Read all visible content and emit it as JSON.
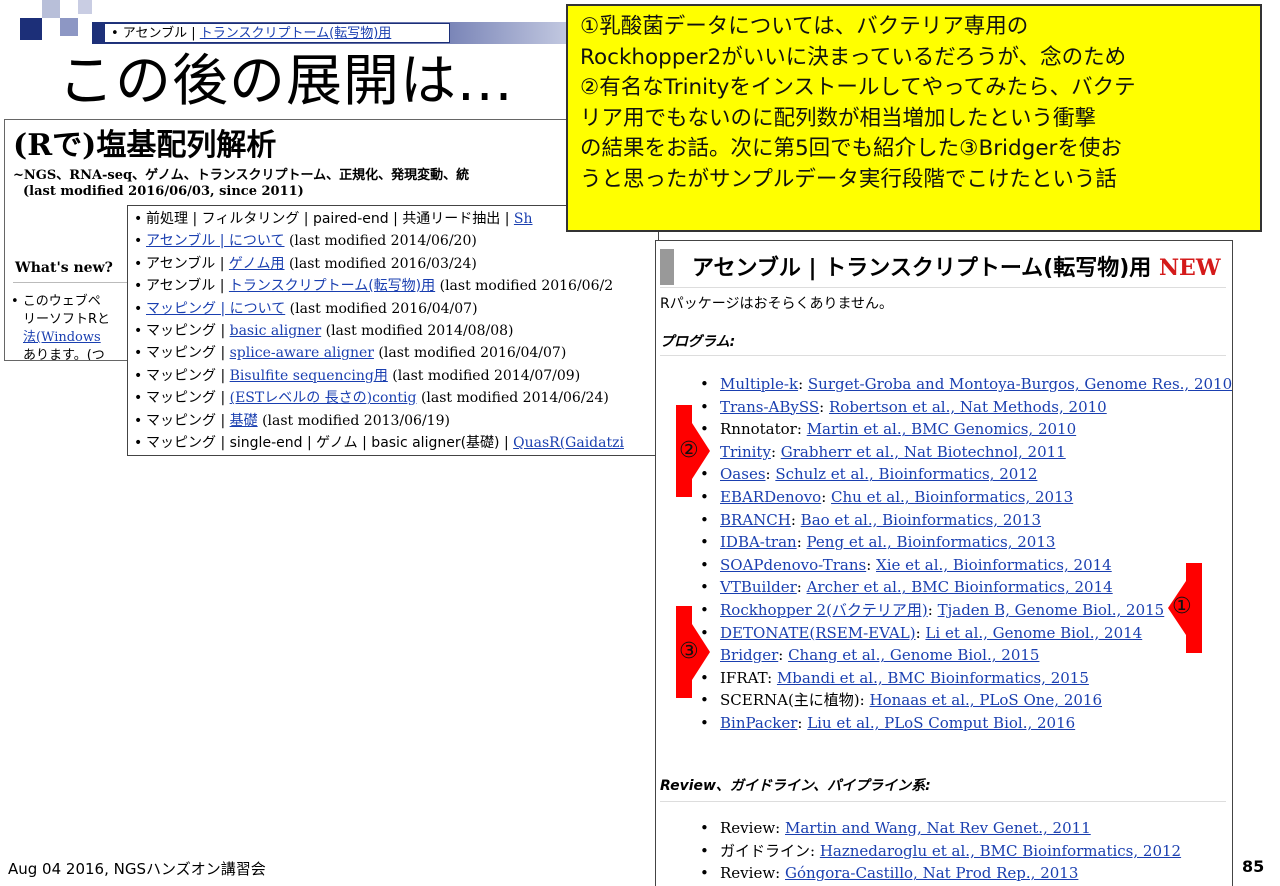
{
  "breadcrumb": {
    "prefix": "• アセンブル | ",
    "link": "トランスクリプトーム(転写物)用"
  },
  "slide_title": "この後の展開は...",
  "site": {
    "title": "(Rで)塩基配列解析",
    "subtitle": "~NGS、RNA-seq、ゲノム、トランスクリプトーム、正規化、発現変動、統",
    "modified": "(last modified 2016/06/03, since 2011)",
    "whats_new": "What's new?",
    "news_lines": [
      "• このウェブペ",
      "リーソフトRと",
      "法(Windows",
      "あります。(つ"
    ]
  },
  "menu": {
    "items": [
      {
        "pre": "前処理 | フィルタリング | paired-end | 共通リード抽出 | ",
        "link": "Sh",
        "post": ""
      },
      {
        "pre": "",
        "link": "アセンブル | について",
        "post": " (last modified 2014/06/20)"
      },
      {
        "pre": "アセンブル | ",
        "link": "ゲノム用",
        "post": " (last modified 2016/03/24)"
      },
      {
        "pre": "アセンブル | ",
        "link": "トランスクリプトーム(転写物)用",
        "post": " (last modified 2016/06/2"
      },
      {
        "pre": "",
        "link": "マッピング | について",
        "post": " (last modified 2016/04/07)"
      },
      {
        "pre": "マッピング | ",
        "link": "basic aligner",
        "post": " (last modified 2014/08/08)"
      },
      {
        "pre": "マッピング | ",
        "link": "splice-aware aligner",
        "post": " (last modified 2016/04/07)"
      },
      {
        "pre": "マッピング | ",
        "link": "Bisulfite sequencing用",
        "post": " (last modified 2014/07/09)"
      },
      {
        "pre": "マッピング | ",
        "link": "(ESTレベルの 長さの)contig",
        "post": " (last modified 2014/06/24)"
      },
      {
        "pre": "マッピング | ",
        "link": "基礎",
        "post": " (last modified 2013/06/19)"
      },
      {
        "pre": "マッピング | single-end | ゲノム | basic aligner(基礎) | ",
        "link": "QuasR(Gaidatzi",
        "post": ""
      }
    ]
  },
  "callout": {
    "lines": [
      "①乳酸菌データについては、バクテリア専用の",
      "Rockhopper2がいいに決まっているだろうが、念のため",
      "②有名なTrinityをインストールしてやってみたら、バクテ",
      "リア用でもないのに配列数が相当増加したという衝撃",
      "の結果をお話。次に第5回でも紹介した③Bridgerを使お",
      "うと思ったがサンプルデータ実行段階でこけたという話"
    ]
  },
  "page": {
    "heading": "アセンブル | トランスクリプトーム(転写物)用",
    "badge": "NEW",
    "note": "Rパッケージはおそらくありません。",
    "programs_label": "プログラム:",
    "programs": [
      {
        "name": "Multiple-k",
        "name_link": true,
        "ref": "Surget-Groba and Montoya-Burgos, Genome Res., 2010"
      },
      {
        "name": "Trans-ABySS",
        "name_link": true,
        "ref": "Robertson et al., Nat Methods, 2010"
      },
      {
        "name": "Rnnotator",
        "name_link": false,
        "ref": "Martin et al., BMC Genomics, 2010"
      },
      {
        "name": "Trinity",
        "name_link": true,
        "ref": "Grabherr et al., Nat Biotechnol, 2011"
      },
      {
        "name": "Oases",
        "name_link": true,
        "ref": "Schulz et al., Bioinformatics, 2012"
      },
      {
        "name": "EBARDenovo",
        "name_link": true,
        "ref": "Chu et al., Bioinformatics, 2013"
      },
      {
        "name": "BRANCH",
        "name_link": true,
        "ref": "Bao et al., Bioinformatics, 2013"
      },
      {
        "name": "IDBA-tran",
        "name_link": true,
        "ref": "Peng et al., Bioinformatics, 2013"
      },
      {
        "name": "SOAPdenovo-Trans",
        "name_link": true,
        "ref": "Xie et al., Bioinformatics, 2014"
      },
      {
        "name": "VTBuilder",
        "name_link": true,
        "ref": "Archer et al., BMC Bioinformatics, 2014"
      },
      {
        "name": "Rockhopper 2(バクテリア用)",
        "name_link": true,
        "ref": "Tjaden B, Genome Biol., 2015"
      },
      {
        "name": "DETONATE(RSEM-EVAL)",
        "name_link": true,
        "ref": "Li et al., Genome Biol., 2014"
      },
      {
        "name": "Bridger",
        "name_link": true,
        "ref": "Chang et al., Genome Biol., 2015"
      },
      {
        "name": "IFRAT",
        "name_link": false,
        "ref": "Mbandi et al., BMC Bioinformatics, 2015"
      },
      {
        "name": "SCERNA(主に植物)",
        "name_link": false,
        "ref": "Honaas et al., PLoS One, 2016"
      },
      {
        "name": "BinPacker",
        "name_link": true,
        "ref": "Liu et al., PLoS Comput Biol., 2016"
      }
    ],
    "review_label": "Review、ガイドライン、パイプライン系:",
    "reviews": [
      {
        "prefix": "Review",
        "ref": "Martin and Wang, Nat Rev Genet., 2011"
      },
      {
        "prefix": "ガイドライン",
        "ref": "Haznedaroglu et al., BMC Bioinformatics, 2012"
      },
      {
        "prefix": "Review",
        "ref": "Góngora-Castillo, Nat Prod Rep., 2013"
      }
    ]
  },
  "markers": {
    "one": "①",
    "two": "②",
    "three": "③",
    "color": "#ff0000"
  },
  "footer": "Aug 04 2016, NGSハンズオン講習会",
  "page_number": "85"
}
